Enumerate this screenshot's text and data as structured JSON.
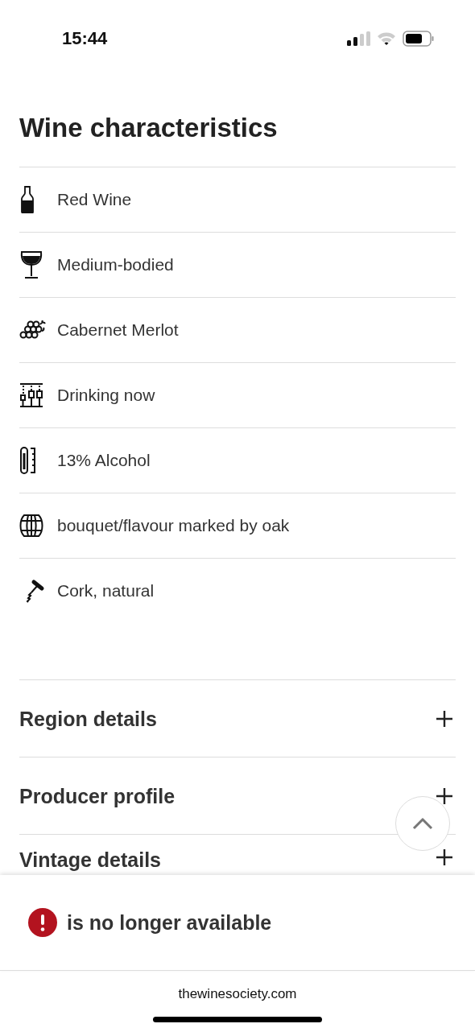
{
  "status_bar": {
    "time": "15:44"
  },
  "title": "Wine characteristics",
  "characteristics": [
    {
      "kind": "bottle",
      "label": "Red Wine"
    },
    {
      "kind": "glass",
      "label": "Medium-bodied"
    },
    {
      "kind": "grapes",
      "label": "Cabernet Merlot"
    },
    {
      "kind": "glasses",
      "label": "Drinking now"
    },
    {
      "kind": "thermometer",
      "label": "13% Alcohol"
    },
    {
      "kind": "barrel",
      "label": "bouquet/flavour marked by oak"
    },
    {
      "kind": "corkscrew",
      "label": "Cork, natural"
    }
  ],
  "sections": [
    {
      "label": "Region details",
      "expanded": false
    },
    {
      "label": "Producer profile",
      "expanded": false
    },
    {
      "label": "Vintage details",
      "expanded": false
    }
  ],
  "banner": {
    "message": "is no longer available"
  },
  "browser": {
    "url": "thewinesociety.com"
  }
}
